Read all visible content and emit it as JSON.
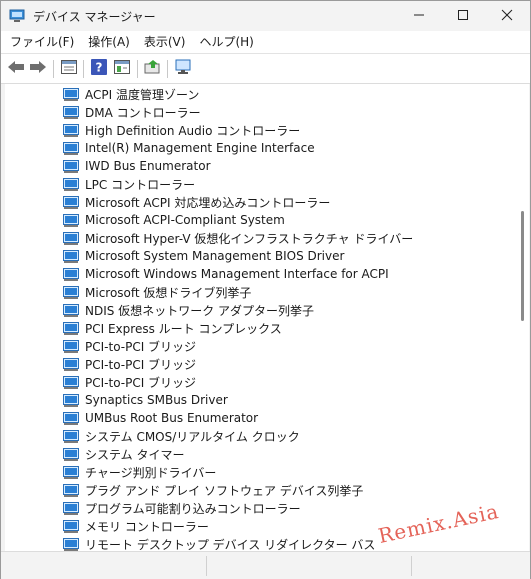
{
  "window": {
    "title": "デバイス マネージャー",
    "controls": {
      "minimize": "minimize",
      "maximize": "maximize",
      "close": "close"
    }
  },
  "menu": {
    "items": [
      "ファイル(F)",
      "操作(A)",
      "表示(V)",
      "ヘルプ(H)"
    ]
  },
  "toolbar": {
    "buttons": [
      "back-icon",
      "forward-icon",
      "properties-icon",
      "help-icon",
      "console-tree-icon",
      "update-driver-icon",
      "scan-hardware-icon"
    ]
  },
  "tree": {
    "items": [
      "ACPI 温度管理ゾーン",
      "DMA コントローラー",
      "High Definition Audio コントローラー",
      "Intel(R) Management Engine Interface",
      "IWD Bus Enumerator",
      "LPC コントローラー",
      "Microsoft ACPI 対応埋め込みコントローラー",
      "Microsoft ACPI-Compliant System",
      "Microsoft Hyper-V 仮想化インフラストラクチャ ドライバー",
      "Microsoft System Management BIOS Driver",
      "Microsoft Windows Management Interface for ACPI",
      "Microsoft 仮想ドライブ列挙子",
      "NDIS 仮想ネットワーク アダプター列挙子",
      "PCI Express ルート コンプレックス",
      "PCI-to-PCI ブリッジ",
      "PCI-to-PCI ブリッジ",
      "PCI-to-PCI ブリッジ",
      "Synaptics SMBus Driver",
      "UMBus Root Bus Enumerator",
      "システム CMOS/リアルタイム クロック",
      "システム タイマー",
      "チャージ判別ドライバー",
      "プラグ アンド プレイ ソフトウェア デバイス列挙子",
      "プログラム可能割り込みコントローラー",
      "メモリ コントローラー",
      "リモート デスクトップ デバイス リダイレクター バス"
    ]
  },
  "watermark": {
    "text": "Remix.Asia",
    "color": "#e0483c"
  },
  "colors": {
    "device_icon": "#2a7fd4",
    "background": "#ffffff"
  }
}
